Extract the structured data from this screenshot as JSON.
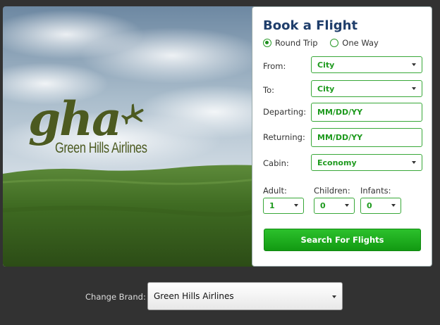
{
  "hero": {
    "logo_mark": "gha",
    "logo_name": "Green Hills Airlines",
    "plane_icon": "airplane-icon",
    "colors": {
      "sky_top": "#6f8aa3",
      "sky_bottom": "#e7ecf0",
      "grass": "#3f6a20",
      "logo": "#4c5a20"
    }
  },
  "form": {
    "title": "Book a Flight",
    "trip_type": {
      "options": [
        "Round Trip",
        "One Way"
      ],
      "selected": "Round Trip"
    },
    "from": {
      "label": "From:",
      "value": "City"
    },
    "to": {
      "label": "To:",
      "value": "City"
    },
    "departing": {
      "label": "Departing:",
      "value": "MM/DD/YY"
    },
    "returning": {
      "label": "Returning:",
      "value": "MM/DD/YY"
    },
    "cabin": {
      "label": "Cabin:",
      "value": "Economy"
    },
    "adult": {
      "label": "Adult:",
      "value": "1"
    },
    "children": {
      "label": "Children:",
      "value": "0"
    },
    "infants": {
      "label": "Infants:",
      "value": "0"
    },
    "search_label": "Search For Flights",
    "accent_color": "#1e9a1e",
    "title_color": "#1f3e6b"
  },
  "footer": {
    "brand_label": "Change Brand:",
    "brand_value": "Green Hills Airlines"
  }
}
